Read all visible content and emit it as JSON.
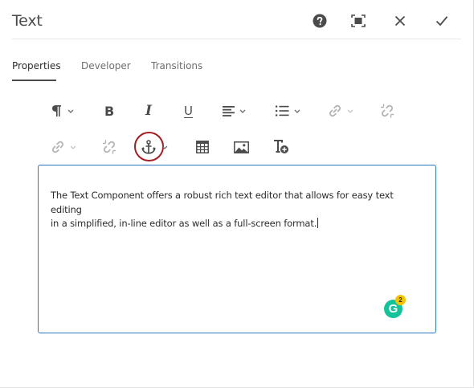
{
  "dialog": {
    "title": "Text",
    "header_actions": [
      {
        "name": "help",
        "icon": "help-icon"
      },
      {
        "name": "fullscreen",
        "icon": "fullscreen-icon"
      },
      {
        "name": "close",
        "icon": "close-icon"
      },
      {
        "name": "done",
        "icon": "checkmark-icon"
      }
    ]
  },
  "tabs": [
    {
      "label": "Properties",
      "active": true
    },
    {
      "label": "Developer",
      "active": false
    },
    {
      "label": "Transitions",
      "active": false
    }
  ],
  "toolbar": {
    "row1": [
      "paragraph-format-icon",
      "bold-icon",
      "italic-icon",
      "underline-icon",
      "justify-icon",
      "list-icon",
      "link-icon",
      "unlink-icon"
    ],
    "row2": [
      "link-icon",
      "unlink-icon",
      "anchor-icon",
      "table-icon",
      "image-icon",
      "special-characters-icon"
    ],
    "highlighted": "anchor-icon",
    "highlight_color": "#a41d21",
    "bold_label": "B",
    "italic_label": "I",
    "underline_label": "U"
  },
  "editor": {
    "line1": "The Text Component offers a robust rich text editor that allows for easy text editing",
    "line2": "in a simplified, in-line editor as well as a full-screen format.",
    "border_color": "#2c76c9"
  },
  "grammarly": {
    "letter": "G",
    "count": "2",
    "color": "#15c39a",
    "badge_color": "#f5c400"
  }
}
